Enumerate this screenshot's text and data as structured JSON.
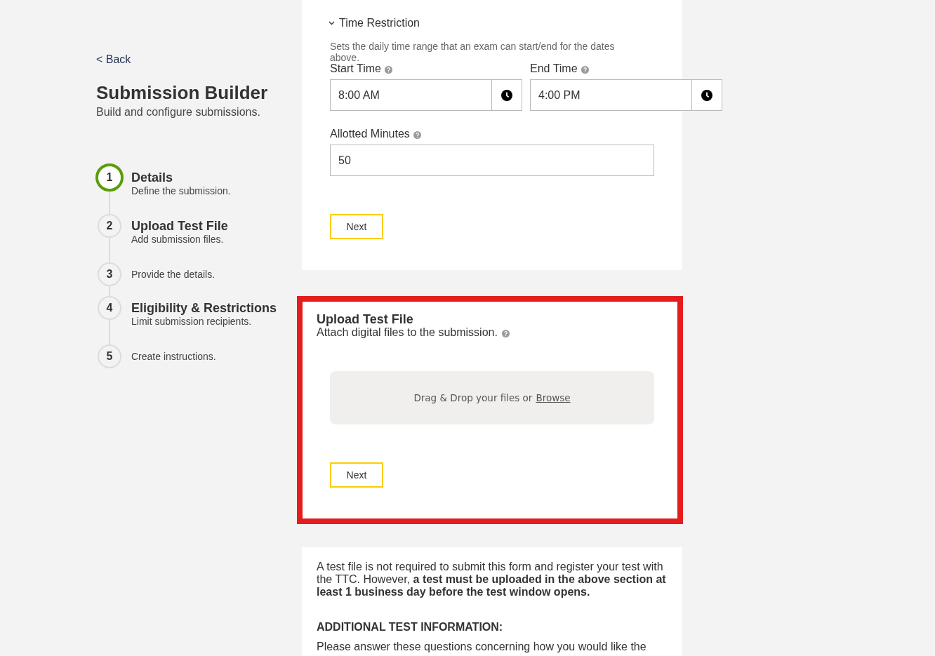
{
  "back_link": {
    "label": "< Back"
  },
  "header": {
    "title": "Submission Builder",
    "subtitle": "Build and configure submissions."
  },
  "steps": [
    {
      "number": "1",
      "title": "Details",
      "description": "Define the submission.",
      "selected": true
    },
    {
      "number": "2",
      "title": "Upload Test File",
      "description": "Add submission files.",
      "selected": false
    },
    {
      "number": "3",
      "description": "Provide the details.",
      "selected": false
    },
    {
      "number": "4",
      "title": "Eligibility & Restrictions",
      "description": "Limit submission recipients.",
      "selected": false
    },
    {
      "number": "5",
      "description": "Create instructions.",
      "selected": false
    }
  ],
  "time_restriction": {
    "title": "Time Restriction",
    "expanded": true,
    "description": "Sets the daily time range that an exam can start/end for the dates above.",
    "time_fields": [
      {
        "label": "Start Time",
        "value": "8:00 AM"
      },
      {
        "label": "End Time",
        "value": "4:00 PM"
      }
    ],
    "allotted_minutes": {
      "label": "Allotted Minutes",
      "value": "50"
    },
    "next_button": "Next"
  },
  "upload_section": {
    "title": "Upload Test File",
    "subtitle": "Attach digital files to the submission.",
    "highlighted": true,
    "dropzone": {
      "text": "Drag & Drop your files or",
      "link": "Browse"
    },
    "next_button": "Next"
  },
  "info": {
    "paragraph": "A test file is not required to submit this form and register your test with the TTC. However, **a test must be uploaded in the above section at least 1 business day before the test window opens.**",
    "heading": "ADDITIONAL TEST INFORMATION:",
    "text": "Please answer these questions concerning how you would like the"
  }
}
